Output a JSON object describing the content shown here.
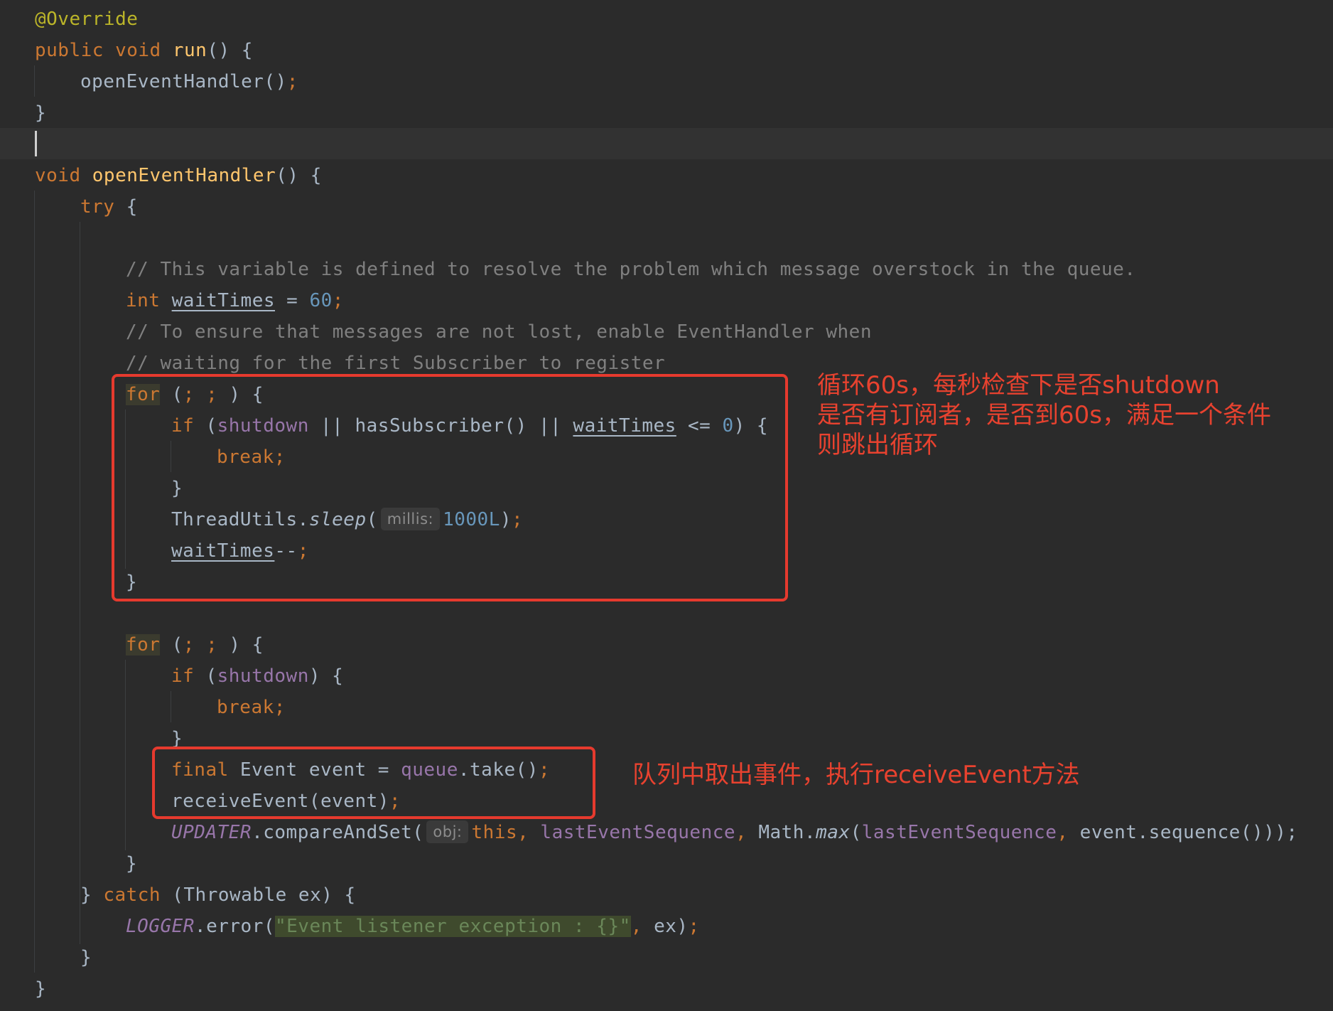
{
  "code": {
    "override": "@Override",
    "public_kw": "public",
    "void_kw": "void",
    "run_name": "run",
    "run_parens": "() {",
    "open_call": "openEventHandler()",
    "semi": ";",
    "close_brace": "}",
    "open_handler_name": "openEventHandler",
    "open_handler_parens": "() {",
    "try_kw": "try",
    "open_brace": " {",
    "comment1": "// This variable is defined to resolve the problem which message overstock in the queue.",
    "int_kw": "int",
    "waitTimes": "waitTimes",
    "assign": " = ",
    "num60": "60",
    "comment2": "// To ensure that messages are not lost, enable EventHandler when",
    "comment3": "// waiting for the first Subscriber to register",
    "for_kw": "for",
    "for_paren_open": " (",
    "for_semis": "; ; ",
    "for_paren_close": ") {",
    "if_kw": "if",
    "paren_open": " (",
    "shutdown": "shutdown",
    "or": " || ",
    "hasSubscriber": "hasSubscriber()",
    "lte": " <= ",
    "num0": "0",
    "paren_close_brace": ") {",
    "break_kw": "break",
    "threadutils": "ThreadUtils.",
    "sleep": "sleep",
    "lparen": "(",
    "hint_millis": "millis:",
    "num1000": "1000L",
    "rparen": ")",
    "decrement": "--",
    "final_kw": "final",
    "event_decl": " Event event = ",
    "queue": "queue",
    "take": ".take()",
    "receive_call": "receiveEvent(event)",
    "updater": "UPDATER",
    "cas": ".compareAndSet(",
    "hint_obj": "obj:",
    "this_kw": "this",
    "comma_sp": ", ",
    "lastEventSequence": "lastEventSequence",
    "math": "Math.",
    "max": "max",
    "event_seq": "event.sequence()",
    "close_cas": "));",
    "catch_close": "} ",
    "catch_kw": "catch",
    "catch_args": " (Throwable ex) {",
    "logger": "LOGGER",
    "error_call": ".error(",
    "log_string": "\"Event listener exception : {}\"",
    "log_tail_comma": ",",
    "log_tail": " ex)"
  },
  "annotations": {
    "loop_note_line1": "循环60s，每秒检查下是否shutdown",
    "loop_note_line2": "是否有订阅者，是否到60s，满足一个条件",
    "loop_note_line3": "则跳出循环",
    "take_note": "队列中取出事件，执行receiveEvent方法"
  },
  "colors": {
    "background": "#2b2b2b",
    "keyword": "#cc7832",
    "annotation": "#bbb529",
    "method": "#ffc66d",
    "number": "#6897bb",
    "comment": "#808080",
    "field": "#9876aa",
    "string": "#6a8759",
    "text": "#a9b7c6",
    "callout": "#e63a2e"
  }
}
